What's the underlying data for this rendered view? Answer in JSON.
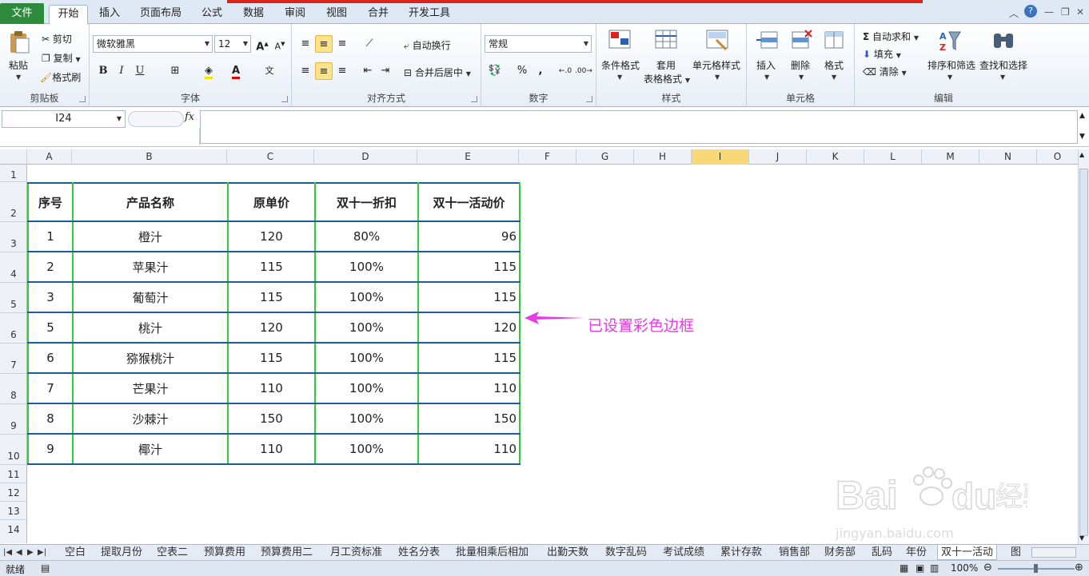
{
  "ribbon_tabs": [
    "文件",
    "开始",
    "插入",
    "页面布局",
    "公式",
    "数据",
    "审阅",
    "视图",
    "合并",
    "开发工具"
  ],
  "clipboard": {
    "paste": "粘贴",
    "cut": "剪切",
    "copy": "复制",
    "format_painter": "格式刷",
    "label": "剪贴板"
  },
  "font": {
    "name": "微软雅黑",
    "size": "12",
    "bold": "B",
    "italic": "I",
    "underline": "U",
    "label": "字体"
  },
  "alignment": {
    "wrap": "自动换行",
    "merge": "合并后居中",
    "label": "对齐方式"
  },
  "number": {
    "format": "常规",
    "percent": "%",
    "comma": ",",
    "label": "数字"
  },
  "styles": {
    "conditional": "条件格式",
    "table_fmt_1": "套用",
    "table_fmt_2": "表格格式",
    "cell_styles": "单元格样式",
    "label": "样式"
  },
  "cells": {
    "insert": "插入",
    "delete": "删除",
    "format": "格式",
    "label": "单元格"
  },
  "editing": {
    "autosum": "自动求和",
    "fill": "填充",
    "clear": "清除",
    "sort": "排序和筛选",
    "find": "查找和选择",
    "label": "编辑"
  },
  "formula_bar": {
    "name_box": "I24",
    "fx": "fx",
    "value": ""
  },
  "columns": [
    "A",
    "B",
    "C",
    "D",
    "E",
    "F",
    "G",
    "H",
    "I",
    "J",
    "K",
    "L",
    "M",
    "N",
    "O"
  ],
  "rows": [
    "1",
    "2",
    "3",
    "4",
    "5",
    "6",
    "7",
    "8",
    "9",
    "10",
    "11",
    "12",
    "13",
    "14"
  ],
  "table": {
    "headers": [
      "序号",
      "产品名称",
      "原单价",
      "双十一折扣",
      "双十一活动价"
    ],
    "rows": [
      [
        "1",
        "橙汁",
        "120",
        "80%",
        "96"
      ],
      [
        "2",
        "苹果汁",
        "115",
        "100%",
        "115"
      ],
      [
        "3",
        "葡萄汁",
        "115",
        "100%",
        "115"
      ],
      [
        "5",
        "桃汁",
        "120",
        "100%",
        "120"
      ],
      [
        "6",
        "猕猴桃汁",
        "115",
        "100%",
        "115"
      ],
      [
        "7",
        "芒果汁",
        "110",
        "100%",
        "110"
      ],
      [
        "8",
        "沙棘汁",
        "150",
        "100%",
        "150"
      ],
      [
        "9",
        "椰汁",
        "110",
        "100%",
        "110"
      ]
    ]
  },
  "annotation": {
    "text": "已设置彩色边框",
    "color": "#e63ce6"
  },
  "border_colors": {
    "outer": "#e040e0",
    "vertical": "#33cc33",
    "horizontal": "#1f5c9e"
  },
  "sheet_tabs": [
    "空白",
    "提取月份",
    "空表二",
    "预算费用",
    "预算费用二",
    "月工资标准",
    "姓名分表",
    "批量相乘后相加",
    "出勤天数",
    "数字乱码",
    "考试成绩",
    "累计存款",
    "销售部",
    "财务部",
    "乱码",
    "年份",
    "双十一活动",
    "图"
  ],
  "active_sheet": "双十一活动",
  "status": {
    "ready": "就绪",
    "zoom": "100%"
  },
  "watermark": {
    "brand": "Bai",
    "brand2": "du",
    "brand_cn": "经验",
    "url": "jingyan.baidu.com"
  }
}
